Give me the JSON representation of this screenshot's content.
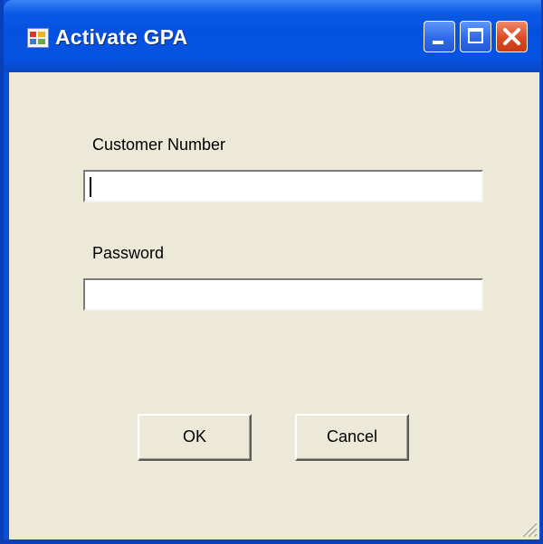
{
  "window": {
    "title": "Activate GPA",
    "icon": "app-icon",
    "controls": [
      "minimize-icon",
      "maximize-icon",
      "close-icon"
    ]
  },
  "form": {
    "customer_number": {
      "label": "Customer Number",
      "value": "",
      "placeholder": ""
    },
    "password": {
      "label": "Password",
      "value": "",
      "placeholder": ""
    }
  },
  "buttons": {
    "ok_label": "OK",
    "cancel_label": "Cancel"
  },
  "colors": {
    "titlebar": "#0551df",
    "window_face": "#ece9d8",
    "close_button": "#dd4a22"
  }
}
